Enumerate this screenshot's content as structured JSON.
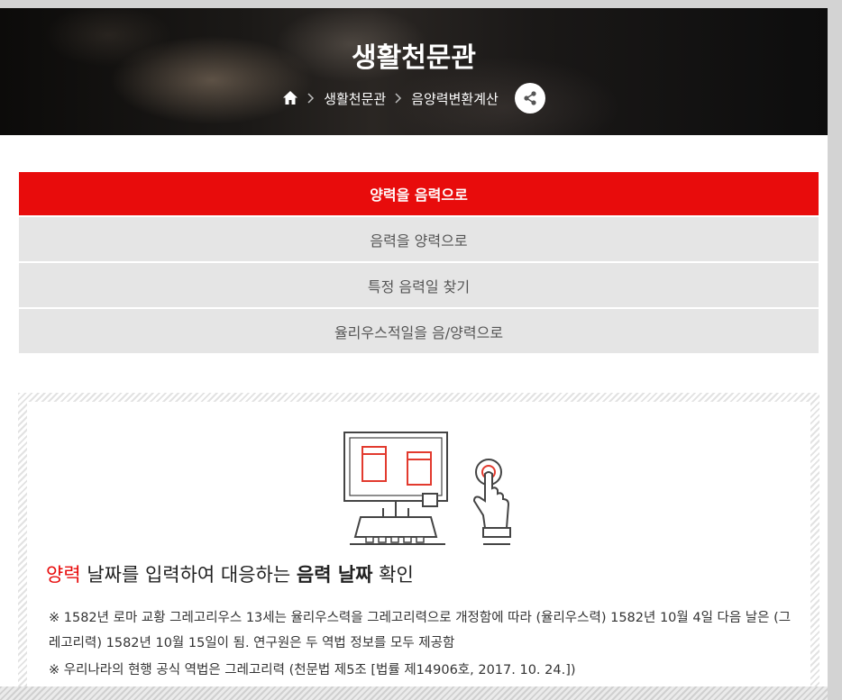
{
  "header": {
    "title": "생활천문관",
    "breadcrumb": [
      "생활천문관",
      "음양력변환계산"
    ]
  },
  "icons": {
    "home": "home-icon",
    "separator": "chevron-right-icon",
    "share": "share-icon"
  },
  "menu": {
    "items": [
      {
        "label": "양력을 음력으로",
        "active": true
      },
      {
        "label": "음력을 양력으로",
        "active": false
      },
      {
        "label": "특정 음력일 찾기",
        "active": false
      },
      {
        "label": "율리우스적일을 음/양력으로",
        "active": false
      }
    ]
  },
  "info": {
    "headline_pre": "양력",
    "headline_mid": " 날짜를 입력하여 대응하는 ",
    "headline_bold": "음력 날짜",
    "headline_post": " 확인",
    "note1": "※ 1582년 로마 교황 그레고리우스 13세는 율리우스력을 그레고리력으로 개정함에 따라 (율리우스력) 1582년 10월 4일 다음 날은 (그레고리력) 1582년 10월 15일이 됨. 연구원은 두 역법 정보를 모두 제공함",
    "note2": "※ 우리나라의 현행 공식 역법은 그레고리력 (천문법 제5조 [법률 제14906호, 2017. 10. 24.])"
  },
  "colors": {
    "accent": "#e80c0c",
    "menu_bg": "#e5e5e5",
    "menu_text": "#555555"
  }
}
